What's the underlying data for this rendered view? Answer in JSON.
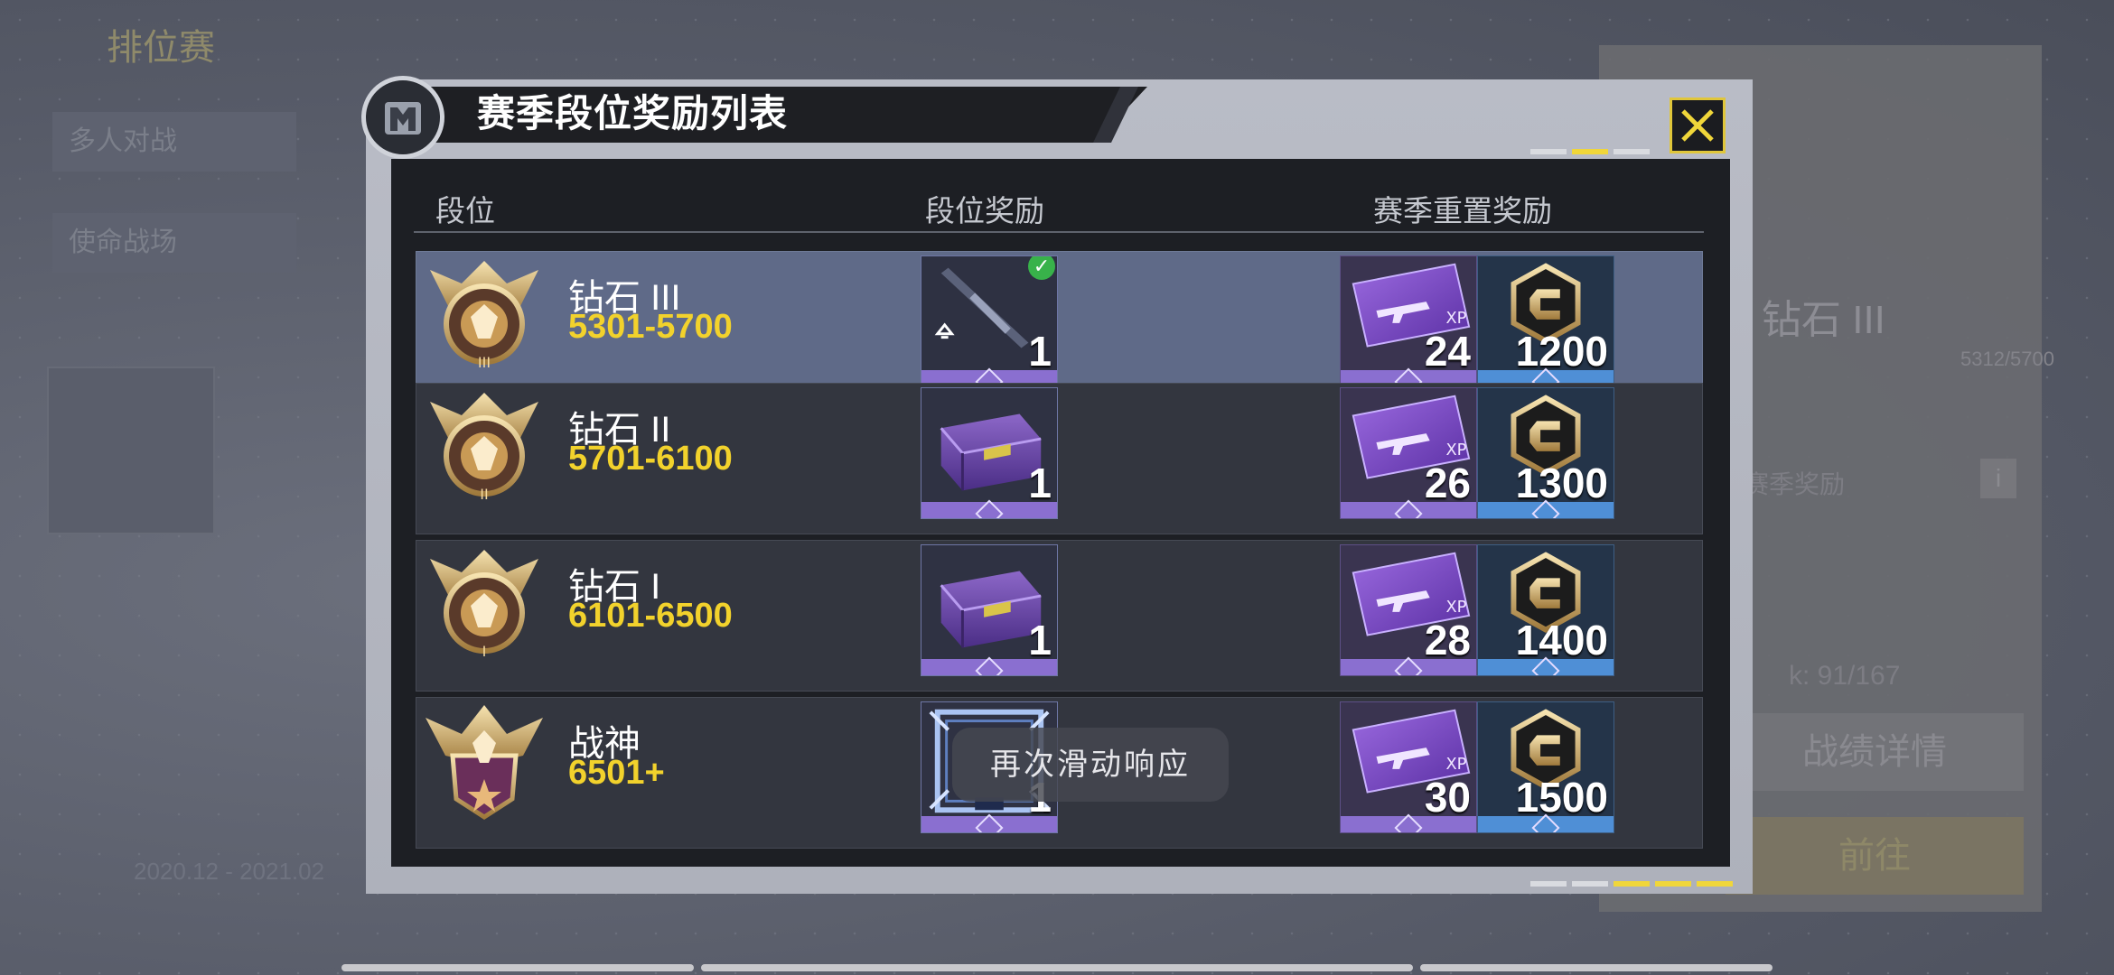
{
  "background": {
    "mode_title": "排位赛",
    "left_tabs": [
      "多人对战",
      "使命战场"
    ],
    "date_range": "2020.12 - 2021.02",
    "right_rank": "钻石 III",
    "right_score": "5312/5700",
    "right_label": "赛季奖励",
    "right_stat": "k: 91/167",
    "right_button_1": "战绩详情",
    "right_button_2": "前往",
    "info_icon": "i"
  },
  "dialog": {
    "title": "赛季段位奖励列表",
    "close_icon": "close-icon",
    "columns": [
      "段位",
      "段位奖励",
      "赛季重置奖励"
    ],
    "rows": [
      {
        "rank": "钻石 III",
        "range": "5301-5700",
        "rank_reward": {
          "type": "weapon-blueprint",
          "count": "1",
          "claimed": true
        },
        "reset_rewards": [
          {
            "type": "weapon-xp-card",
            "count": "24"
          },
          {
            "type": "cod-points",
            "count": "1200"
          }
        ],
        "current": true
      },
      {
        "rank": "钻石 II",
        "range": "5701-6100",
        "rank_reward": {
          "type": "supply-crate",
          "count": "1",
          "claimed": false
        },
        "reset_rewards": [
          {
            "type": "weapon-xp-card",
            "count": "26"
          },
          {
            "type": "cod-points",
            "count": "1300"
          }
        ],
        "current": false
      },
      {
        "rank": "钻石 I",
        "range": "6101-6500",
        "rank_reward": {
          "type": "supply-crate",
          "count": "1",
          "claimed": false
        },
        "reset_rewards": [
          {
            "type": "weapon-xp-card",
            "count": "28"
          },
          {
            "type": "cod-points",
            "count": "1400"
          }
        ],
        "current": false
      },
      {
        "rank": "战神",
        "range": "6501+",
        "rank_reward": {
          "type": "avatar-frame",
          "count": "1",
          "claimed": false
        },
        "reset_rewards": [
          {
            "type": "weapon-xp-card",
            "count": "30"
          },
          {
            "type": "cod-points",
            "count": "1500"
          }
        ],
        "current": false
      }
    ]
  },
  "toast": "再次滑动响应",
  "colors": {
    "accent_yellow": "#f2d22c",
    "current_row": "#5f6a88",
    "row": "#33363f",
    "reward_purple": "#8a6fd0",
    "cp_blue": "#4f8fd6",
    "claimed_green": "#38b24a"
  }
}
